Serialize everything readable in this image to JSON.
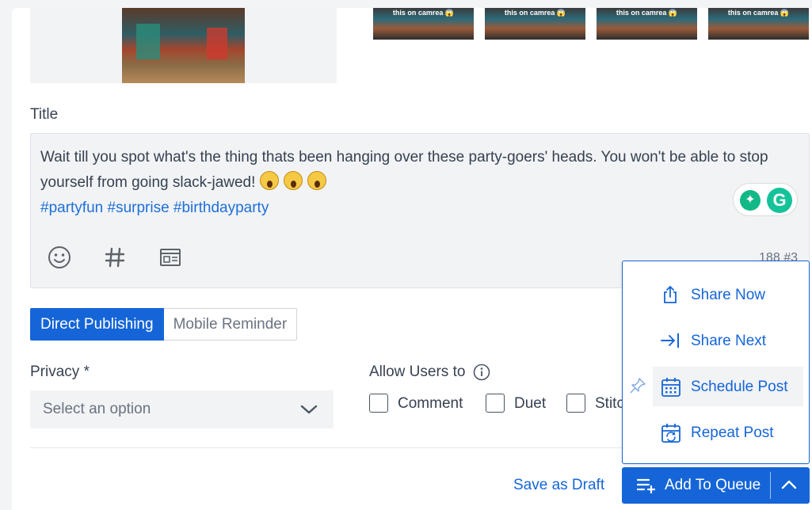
{
  "media": {
    "frame_caption": "this on camrea 😱",
    "frame_count": 4
  },
  "title_section": {
    "label": "Title",
    "caption_line": "Wait till you spot what's the thing thats been hanging over these party-goers' heads. You won't be able to stop yourself from going slack-jawed!",
    "hashtags": "#partyfun #surprise #birthdayparty",
    "char_count": "188",
    "hashtag_count": "3"
  },
  "toolbar_icons": [
    "emoji-icon",
    "hashtag-icon",
    "template-icon"
  ],
  "publish_tabs": {
    "active": "Direct Publishing",
    "inactive": "Mobile Reminder"
  },
  "privacy": {
    "label": "Privacy *",
    "placeholder": "Select an option"
  },
  "allow_users": {
    "label": "Allow Users to",
    "options": [
      "Comment",
      "Duet",
      "Stitch"
    ]
  },
  "actions": {
    "save_draft": "Save as Draft",
    "add_to_queue": "Add To Queue"
  },
  "queue_menu": {
    "items": [
      "Share Now",
      "Share Next",
      "Schedule Post",
      "Repeat Post"
    ],
    "highlighted": "Schedule Post"
  },
  "colors": {
    "accent": "#1565d8",
    "field_bg": "#f1f3f5",
    "text": "#374151"
  }
}
